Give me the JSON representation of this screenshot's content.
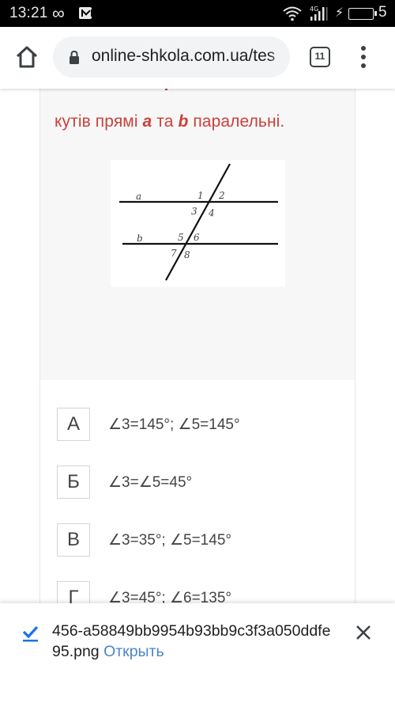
{
  "status_bar": {
    "time": "13:21",
    "notification_icons": [
      "infinity-icon",
      "gmail-icon"
    ],
    "system_icons": [
      "wifi-icon",
      "4g-signal-icon",
      "charging-bolt-icon",
      "battery-icon"
    ],
    "network_label": "4G",
    "battery_level": "5"
  },
  "browser": {
    "url": "online-shkola.com.ua/tes",
    "tab_count": "11"
  },
  "question": {
    "text_before_a": "кутів прямі ",
    "var_a": "a",
    "text_between": " та ",
    "var_b": "b",
    "text_after_b": " паралельні.",
    "diagram": {
      "line_labels": [
        "a",
        "b"
      ],
      "angle_labels": [
        "1",
        "2",
        "3",
        "4",
        "5",
        "6",
        "7",
        "8"
      ]
    }
  },
  "answers": [
    {
      "letter": "А",
      "text": "∠3=145°; ∠5=145°"
    },
    {
      "letter": "Б",
      "text": "∠3=∠5=45°"
    },
    {
      "letter": "В",
      "text": "∠3=35°; ∠5=145°"
    },
    {
      "letter": "Г",
      "text": "∠3=45°; ∠6=135°"
    }
  ],
  "download": {
    "filename": "456-a58849bb9954b93bb9c3f3a050ddfe95.png",
    "open_label": "Открыть",
    "colors": {
      "accent": "#4a86c7",
      "check": "#1a73e8"
    }
  },
  "colors": {
    "question_text": "#c9413b",
    "question_bg": "#f7f7f7"
  }
}
